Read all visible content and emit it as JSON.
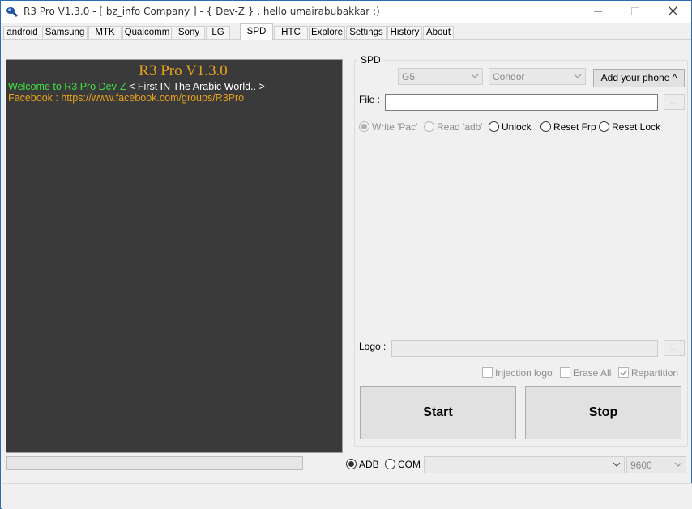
{
  "window": {
    "title": "R3 Pro V1.3.0 - [ bz_info Company ] -  { Dev-Z } , hello umairabubakkar :)",
    "icons": {
      "app": "app-icon",
      "minimize": "minimize-icon",
      "maximize": "maximize-icon",
      "close": "close-icon"
    }
  },
  "tabs": [
    {
      "label": "android"
    },
    {
      "label": "Samsung"
    },
    {
      "label": "MTK"
    },
    {
      "label": "Qualcomm"
    },
    {
      "label": "Sony"
    },
    {
      "label": "LG"
    },
    {
      "label": "SPD",
      "active": true
    },
    {
      "label": "HTC"
    },
    {
      "label": "Explore"
    },
    {
      "label": "Settings"
    },
    {
      "label": "History"
    },
    {
      "label": "About"
    }
  ],
  "console": {
    "title": "R3 Pro V1.3.0",
    "welcome": "Welcome to R3 Pro Dev-Z",
    "tagline": " < First IN The Arabic World.. >",
    "facebook": "Facebook : https://www.facebook.com/groups/R3Pro"
  },
  "spd": {
    "group_label": "SPD",
    "model_select": "G5",
    "brand_select": "Condor",
    "add_phone_button": "Add your phone ^",
    "file_label": "File :",
    "file_value": "",
    "browse_button": "...",
    "options": {
      "write_pac": "Write 'Pac'",
      "read_adb": "Read 'adb'",
      "unlock": "Unlock",
      "reset_frp": "Reset Frp",
      "reset_lock": "Reset Lock"
    },
    "logo_label": "Logo :",
    "logo_value": "",
    "logo_browse_button": "...",
    "checks": {
      "injection_logo": "Injection logo",
      "erase_all": "Erase All",
      "repartition": "Repartition"
    },
    "start_button": "Start",
    "stop_button": "Stop"
  },
  "bottom": {
    "progress": 0,
    "adb_label": "ADB",
    "com_label": "COM",
    "port_select": "",
    "baud_select": "9600"
  },
  "colors": {
    "console_bg": "#3a3a3a",
    "console_title": "#e8a21c",
    "welcome": "#41e041",
    "link": "#e8a21c"
  }
}
